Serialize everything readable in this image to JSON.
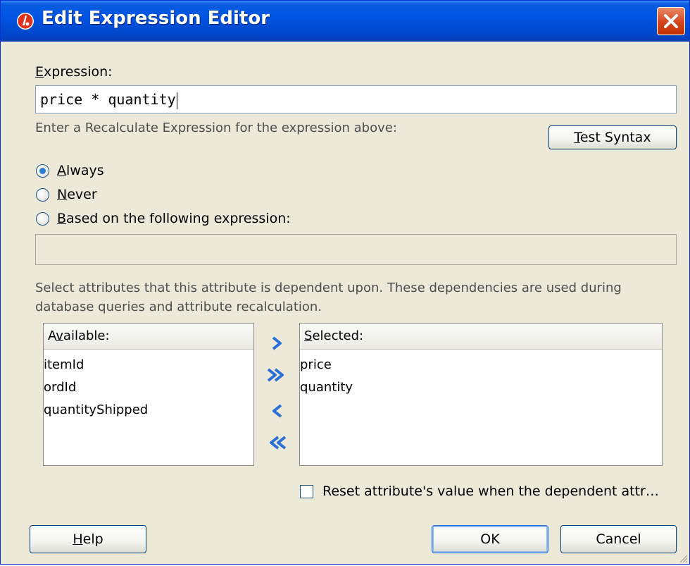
{
  "window": {
    "title": "Edit Expression Editor",
    "accent_color": "#0054e3",
    "icons": {
      "app": "oracle-app-icon",
      "close": "close-icon"
    }
  },
  "expression": {
    "label_underline": "E",
    "label_rest": "xpression:",
    "value": "price * quantity"
  },
  "recalc": {
    "hint": "Enter a Recalculate Expression for the expression above:",
    "test_syntax_underline": "T",
    "test_syntax_rest": "est Syntax",
    "options": [
      {
        "underline": "A",
        "rest": "lways",
        "selected": true
      },
      {
        "underline": "N",
        "rest": "ever",
        "selected": false
      },
      {
        "underline": "B",
        "rest": "ased on the following expression:",
        "selected": false
      }
    ],
    "expression_value": ""
  },
  "dependencies": {
    "description_line1": "Select attributes that this attribute is dependent upon. These dependencies are used during",
    "description_line2": "database queries and attribute recalculation.",
    "available_label_pre": "A",
    "available_label_underline": "v",
    "available_label_rest": "ailable:",
    "available_items": [
      "itemId",
      "ordId",
      "quantityShipped"
    ],
    "selected_label_underline": "S",
    "selected_label_rest": "elected:",
    "selected_items": [
      "price",
      "quantity"
    ],
    "shuttle_icons": [
      "move-right-icon",
      "move-all-right-icon",
      "move-left-icon",
      "move-all-left-icon"
    ]
  },
  "reset_checkbox": {
    "label": "Reset attribute's value when the dependent attr…",
    "checked": false
  },
  "buttons": {
    "help_underline": "H",
    "help_rest": "elp",
    "ok": "OK",
    "cancel": "Cancel"
  }
}
